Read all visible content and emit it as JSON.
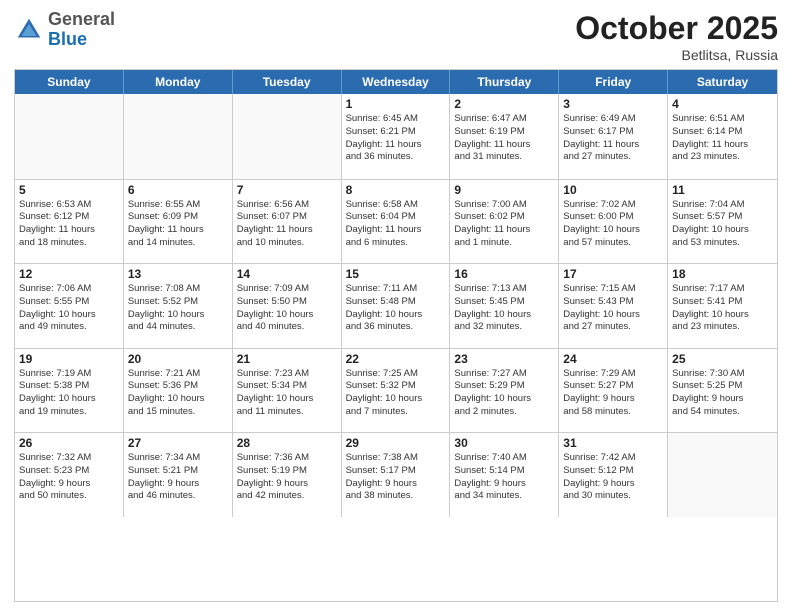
{
  "header": {
    "logo_general": "General",
    "logo_blue": "Blue",
    "month": "October 2025",
    "location": "Betlitsa, Russia"
  },
  "weekdays": [
    "Sunday",
    "Monday",
    "Tuesday",
    "Wednesday",
    "Thursday",
    "Friday",
    "Saturday"
  ],
  "rows": [
    [
      {
        "day": "",
        "info": ""
      },
      {
        "day": "",
        "info": ""
      },
      {
        "day": "",
        "info": ""
      },
      {
        "day": "1",
        "info": "Sunrise: 6:45 AM\nSunset: 6:21 PM\nDaylight: 11 hours\nand 36 minutes."
      },
      {
        "day": "2",
        "info": "Sunrise: 6:47 AM\nSunset: 6:19 PM\nDaylight: 11 hours\nand 31 minutes."
      },
      {
        "day": "3",
        "info": "Sunrise: 6:49 AM\nSunset: 6:17 PM\nDaylight: 11 hours\nand 27 minutes."
      },
      {
        "day": "4",
        "info": "Sunrise: 6:51 AM\nSunset: 6:14 PM\nDaylight: 11 hours\nand 23 minutes."
      }
    ],
    [
      {
        "day": "5",
        "info": "Sunrise: 6:53 AM\nSunset: 6:12 PM\nDaylight: 11 hours\nand 18 minutes."
      },
      {
        "day": "6",
        "info": "Sunrise: 6:55 AM\nSunset: 6:09 PM\nDaylight: 11 hours\nand 14 minutes."
      },
      {
        "day": "7",
        "info": "Sunrise: 6:56 AM\nSunset: 6:07 PM\nDaylight: 11 hours\nand 10 minutes."
      },
      {
        "day": "8",
        "info": "Sunrise: 6:58 AM\nSunset: 6:04 PM\nDaylight: 11 hours\nand 6 minutes."
      },
      {
        "day": "9",
        "info": "Sunrise: 7:00 AM\nSunset: 6:02 PM\nDaylight: 11 hours\nand 1 minute."
      },
      {
        "day": "10",
        "info": "Sunrise: 7:02 AM\nSunset: 6:00 PM\nDaylight: 10 hours\nand 57 minutes."
      },
      {
        "day": "11",
        "info": "Sunrise: 7:04 AM\nSunset: 5:57 PM\nDaylight: 10 hours\nand 53 minutes."
      }
    ],
    [
      {
        "day": "12",
        "info": "Sunrise: 7:06 AM\nSunset: 5:55 PM\nDaylight: 10 hours\nand 49 minutes."
      },
      {
        "day": "13",
        "info": "Sunrise: 7:08 AM\nSunset: 5:52 PM\nDaylight: 10 hours\nand 44 minutes."
      },
      {
        "day": "14",
        "info": "Sunrise: 7:09 AM\nSunset: 5:50 PM\nDaylight: 10 hours\nand 40 minutes."
      },
      {
        "day": "15",
        "info": "Sunrise: 7:11 AM\nSunset: 5:48 PM\nDaylight: 10 hours\nand 36 minutes."
      },
      {
        "day": "16",
        "info": "Sunrise: 7:13 AM\nSunset: 5:45 PM\nDaylight: 10 hours\nand 32 minutes."
      },
      {
        "day": "17",
        "info": "Sunrise: 7:15 AM\nSunset: 5:43 PM\nDaylight: 10 hours\nand 27 minutes."
      },
      {
        "day": "18",
        "info": "Sunrise: 7:17 AM\nSunset: 5:41 PM\nDaylight: 10 hours\nand 23 minutes."
      }
    ],
    [
      {
        "day": "19",
        "info": "Sunrise: 7:19 AM\nSunset: 5:38 PM\nDaylight: 10 hours\nand 19 minutes."
      },
      {
        "day": "20",
        "info": "Sunrise: 7:21 AM\nSunset: 5:36 PM\nDaylight: 10 hours\nand 15 minutes."
      },
      {
        "day": "21",
        "info": "Sunrise: 7:23 AM\nSunset: 5:34 PM\nDaylight: 10 hours\nand 11 minutes."
      },
      {
        "day": "22",
        "info": "Sunrise: 7:25 AM\nSunset: 5:32 PM\nDaylight: 10 hours\nand 7 minutes."
      },
      {
        "day": "23",
        "info": "Sunrise: 7:27 AM\nSunset: 5:29 PM\nDaylight: 10 hours\nand 2 minutes."
      },
      {
        "day": "24",
        "info": "Sunrise: 7:29 AM\nSunset: 5:27 PM\nDaylight: 9 hours\nand 58 minutes."
      },
      {
        "day": "25",
        "info": "Sunrise: 7:30 AM\nSunset: 5:25 PM\nDaylight: 9 hours\nand 54 minutes."
      }
    ],
    [
      {
        "day": "26",
        "info": "Sunrise: 7:32 AM\nSunset: 5:23 PM\nDaylight: 9 hours\nand 50 minutes."
      },
      {
        "day": "27",
        "info": "Sunrise: 7:34 AM\nSunset: 5:21 PM\nDaylight: 9 hours\nand 46 minutes."
      },
      {
        "day": "28",
        "info": "Sunrise: 7:36 AM\nSunset: 5:19 PM\nDaylight: 9 hours\nand 42 minutes."
      },
      {
        "day": "29",
        "info": "Sunrise: 7:38 AM\nSunset: 5:17 PM\nDaylight: 9 hours\nand 38 minutes."
      },
      {
        "day": "30",
        "info": "Sunrise: 7:40 AM\nSunset: 5:14 PM\nDaylight: 9 hours\nand 34 minutes."
      },
      {
        "day": "31",
        "info": "Sunrise: 7:42 AM\nSunset: 5:12 PM\nDaylight: 9 hours\nand 30 minutes."
      },
      {
        "day": "",
        "info": ""
      }
    ]
  ]
}
